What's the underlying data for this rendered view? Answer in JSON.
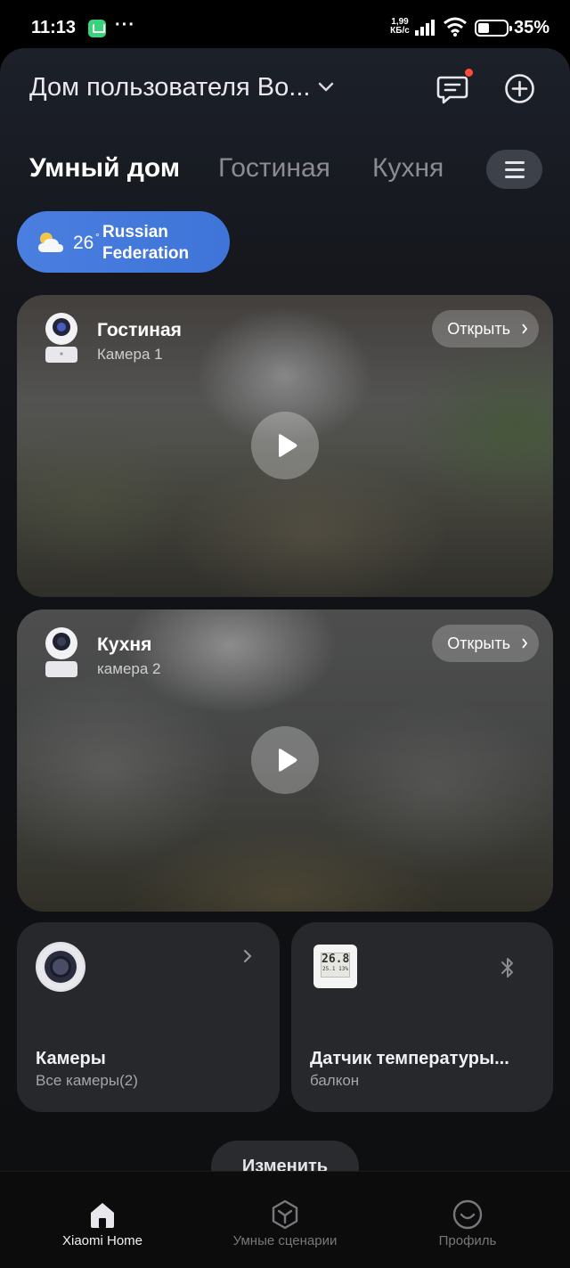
{
  "status_bar": {
    "time": "11:13",
    "dots": "···",
    "speed_value": "1,99",
    "speed_unit": "КБ/с",
    "battery": "35%"
  },
  "header": {
    "home_name": "Дом пользователя Во...",
    "icons": [
      "messages-icon",
      "add-circle-icon",
      "chevron-down-icon"
    ]
  },
  "tabs": {
    "items": [
      {
        "label": "Умный дом",
        "active": true
      },
      {
        "label": "Гостиная",
        "active": false
      },
      {
        "label": "Кухня",
        "active": false
      }
    ]
  },
  "weather": {
    "temperature": "26",
    "degree": "°",
    "location": "Russian Federation"
  },
  "cameras": [
    {
      "room": "Гостиная",
      "name": "Камера 1",
      "open_label": "Открыть"
    },
    {
      "room": "Кухня",
      "name": "камера 2",
      "open_label": "Открыть"
    }
  ],
  "tiles": [
    {
      "name": "Камеры",
      "sub": "Все камеры(2)"
    },
    {
      "name": "Датчик температуры...",
      "sub": "балкон",
      "screen_top": "26.8",
      "screen_bottom": "25.1 13%"
    }
  ],
  "edit_label": "Изменить",
  "bottom_nav": [
    {
      "label": "Xiaomi Home",
      "icon": "home-icon",
      "active": true
    },
    {
      "label": "Умные сценарии",
      "icon": "scenes-icon",
      "active": false
    },
    {
      "label": "Профиль",
      "icon": "profile-icon",
      "active": false
    }
  ],
  "colors": {
    "accent_blue": "#4a7fe0",
    "notification_dot": "#ff4a3d",
    "tile_bg": "#27282b"
  }
}
